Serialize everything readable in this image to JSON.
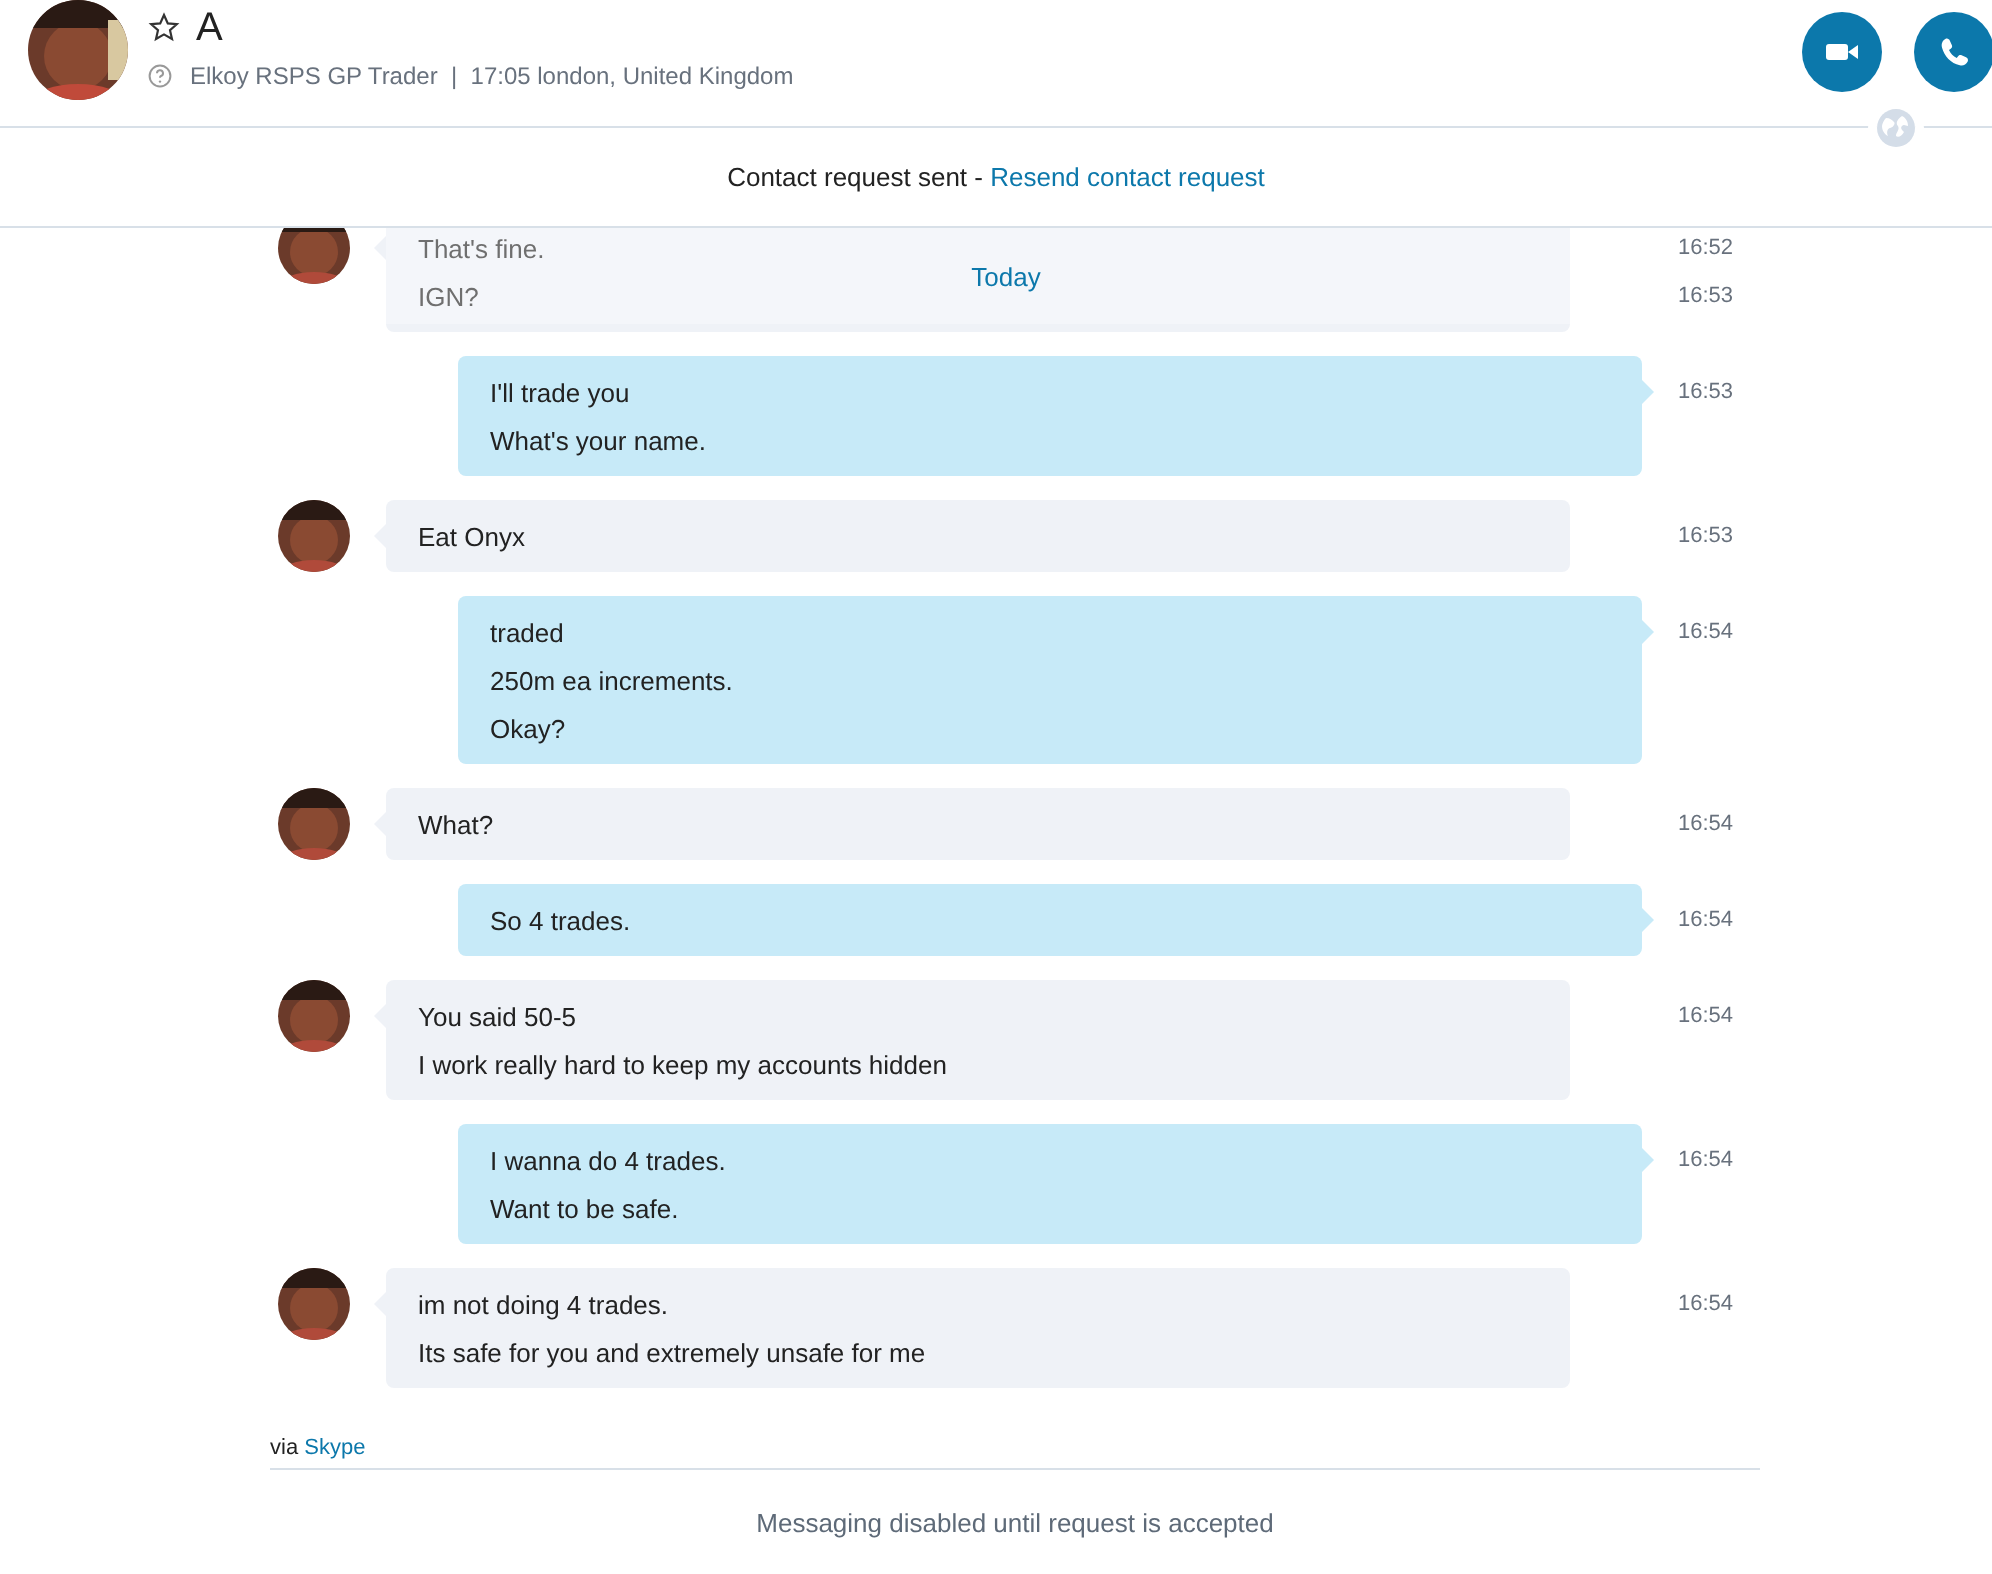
{
  "contact": {
    "name": "A",
    "favorite": false,
    "status_line": "Elkoy RSPS GP Trader  |  17:05 london, United Kingdom"
  },
  "request_bar": {
    "text": "Contact request sent - ",
    "link": "Resend contact request"
  },
  "date_divider": "Today",
  "messages": [
    {
      "outgoing": false,
      "lines": [
        {
          "text": "That's fine.",
          "time": "16:52"
        },
        {
          "text": "IGN?",
          "time": "16:53"
        }
      ]
    },
    {
      "outgoing": true,
      "lines": [
        {
          "text": "I'll trade you",
          "time": "16:53"
        },
        {
          "text": "What's your name."
        }
      ]
    },
    {
      "outgoing": false,
      "lines": [
        {
          "text": "Eat Onyx",
          "time": "16:53"
        }
      ]
    },
    {
      "outgoing": true,
      "lines": [
        {
          "text": "traded",
          "time": "16:54"
        },
        {
          "text": "250m ea increments."
        },
        {
          "text": "Okay?"
        }
      ]
    },
    {
      "outgoing": false,
      "lines": [
        {
          "text": "What?",
          "time": "16:54"
        }
      ]
    },
    {
      "outgoing": true,
      "lines": [
        {
          "text": "So 4 trades.",
          "time": "16:54"
        }
      ]
    },
    {
      "outgoing": false,
      "lines": [
        {
          "text": "You said 50-5",
          "time": "16:54"
        },
        {
          "text": "I work really hard to keep my accounts hidden"
        }
      ]
    },
    {
      "outgoing": true,
      "lines": [
        {
          "text": "I wanna do 4 trades.",
          "time": "16:54"
        },
        {
          "text": "Want to be safe."
        }
      ]
    },
    {
      "outgoing": false,
      "lines": [
        {
          "text": "im not doing 4 trades.",
          "time": "16:54"
        },
        {
          "text": "Its safe for you and extremely unsafe for me"
        }
      ]
    }
  ],
  "via": {
    "prefix": "via ",
    "link": "Skype"
  },
  "footer_notice": "Messaging disabled until request is accepted"
}
